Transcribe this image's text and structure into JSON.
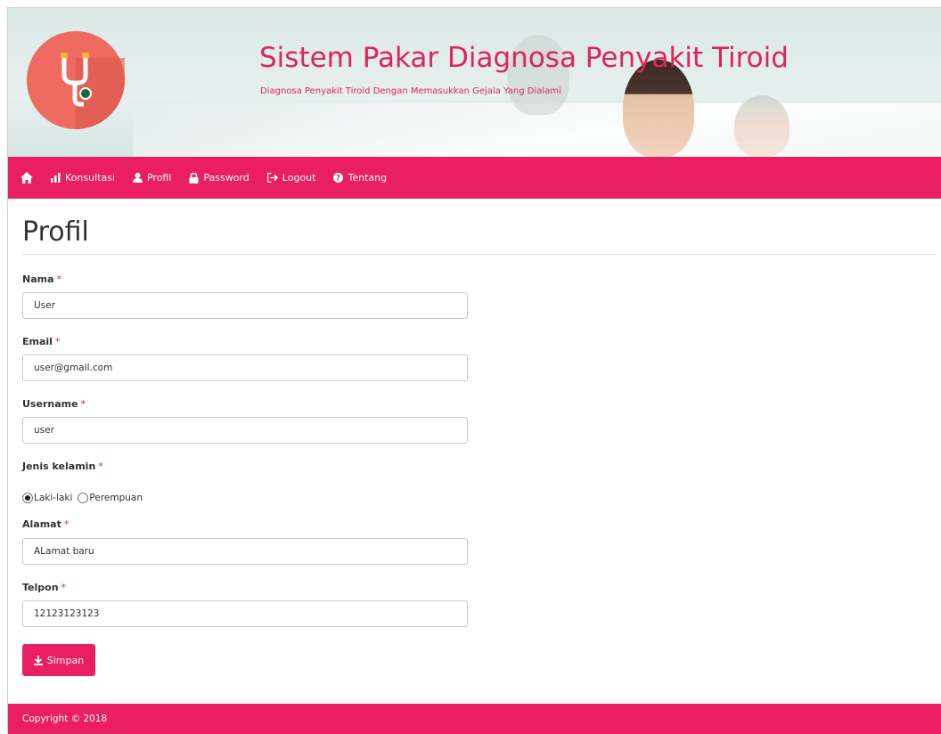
{
  "header": {
    "title": "Sistem Pakar Diagnosa Penyakit Tiroid",
    "subtitle": "Diagnosa Penyakit Tiroid Dengan Memasukkan Gejala Yang Dialami",
    "logo_icon": "stethoscope-icon",
    "accent_color": "#e91e63",
    "logo_color": "#ef6a61"
  },
  "nav": {
    "items": [
      {
        "icon": "home-icon",
        "label": ""
      },
      {
        "icon": "bar-chart-icon",
        "label": "Konsultasi"
      },
      {
        "icon": "user-icon",
        "label": "Profil"
      },
      {
        "icon": "lock-icon",
        "label": "Password"
      },
      {
        "icon": "logout-icon",
        "label": "Logout"
      },
      {
        "icon": "question-circle-icon",
        "label": "Tentang"
      }
    ]
  },
  "page": {
    "title": "Profil"
  },
  "form": {
    "required_mark": "*",
    "nama": {
      "label": "Nama",
      "value": "User"
    },
    "email": {
      "label": "Email",
      "value": "user@gmail.com"
    },
    "username": {
      "label": "Username",
      "value": "user"
    },
    "jenis_kelamin": {
      "label": "Jenis kelamin",
      "options": [
        "Laki-laki",
        "Perempuan"
      ],
      "selected": "Laki-laki"
    },
    "alamat": {
      "label": "Alamat",
      "value": "ALamat baru"
    },
    "telpon": {
      "label": "Telpon",
      "value": "12123123123"
    },
    "submit": {
      "label": "Simpan",
      "icon": "download-icon"
    }
  },
  "footer": {
    "copyright": "Copyright © 2018"
  }
}
